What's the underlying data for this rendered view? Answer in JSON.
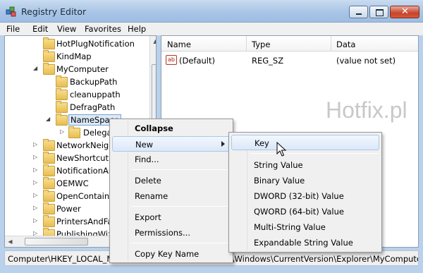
{
  "window": {
    "title": "Registry Editor"
  },
  "menubar": [
    "File",
    "Edit",
    "View",
    "Favorites",
    "Help"
  ],
  "tree": {
    "items": [
      {
        "label": "HotPlugNotification",
        "expander": ""
      },
      {
        "label": "KindMap",
        "expander": ""
      },
      {
        "label": "MyComputer",
        "expander": "◢"
      },
      {
        "label": "BackupPath",
        "expander": ""
      },
      {
        "label": "cleanuppath",
        "expander": ""
      },
      {
        "label": "DefragPath",
        "expander": ""
      },
      {
        "label": "NameSpace",
        "expander": "◢"
      },
      {
        "label": "DelegateFolders",
        "expander": "▷"
      },
      {
        "label": "NetworkNeighborhood",
        "expander": "▷"
      },
      {
        "label": "NewShortcutHandlers",
        "expander": "▷"
      },
      {
        "label": "NotificationArea",
        "expander": "▷"
      },
      {
        "label": "OEMWC",
        "expander": "▷"
      },
      {
        "label": "OpenContainingFolder",
        "expander": "▷"
      },
      {
        "label": "Power",
        "expander": "▷"
      },
      {
        "label": "PrintersAndFaxes",
        "expander": "▷"
      },
      {
        "label": "PublishingWizard",
        "expander": "▷"
      }
    ]
  },
  "values": {
    "columns": [
      "Name",
      "Type",
      "Data"
    ],
    "rows": [
      {
        "name": "(Default)",
        "type": "REG_SZ",
        "data": "(value not set)",
        "icon": "ab"
      }
    ]
  },
  "watermark": "Hotfix.pl",
  "status": {
    "path": "Computer\\HKEY_LOCAL_MACHINE\\SOFTWARE\\Microsoft\\Windows\\CurrentVersion\\Explorer\\MyComputer"
  },
  "context_menu": {
    "items": [
      "Collapse",
      "New",
      "Find...",
      "Delete",
      "Rename",
      "Export",
      "Permissions...",
      "Copy Key Name"
    ],
    "highlighted": "New"
  },
  "submenu": {
    "items": [
      "Key",
      "String Value",
      "Binary Value",
      "DWORD (32-bit) Value",
      "QWORD (64-bit) Value",
      "Multi-String Value",
      "Expandable String Value"
    ],
    "highlighted": "Key"
  },
  "icons": {
    "app": "registry-editor-icon",
    "folder": "folder-icon",
    "string_value": "string-value-icon",
    "cursor": "mouse-pointer-icon"
  }
}
